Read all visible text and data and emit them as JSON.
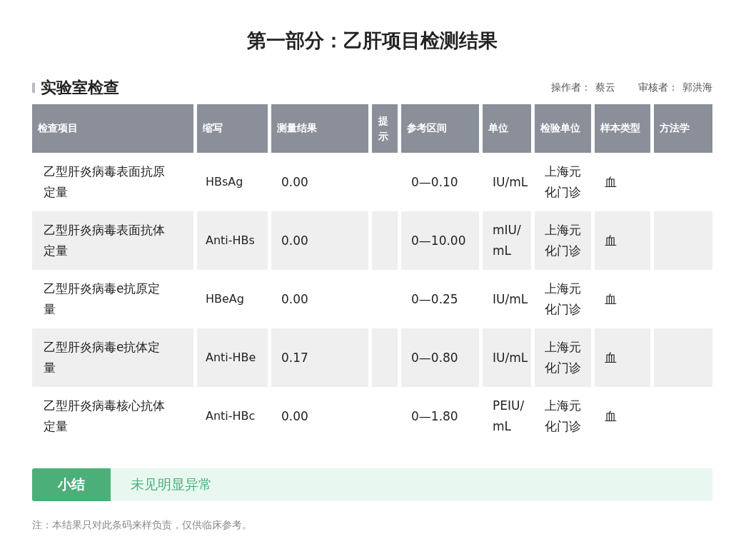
{
  "title": "第一部分：乙肝项目检测结果",
  "section": {
    "title": "实验室检查",
    "operator_label": "操作者：",
    "operator": "蔡云",
    "reviewer_label": "审核者：",
    "reviewer": "郭洪海"
  },
  "table": {
    "columns": [
      {
        "label": "检查项目"
      },
      {
        "label": "缩写"
      },
      {
        "label": "测量结果"
      },
      {
        "label": "提示"
      },
      {
        "label": "参考区间"
      },
      {
        "label": "单位"
      },
      {
        "label": "检验单位"
      },
      {
        "label": "样本类型"
      },
      {
        "label": "方法学"
      }
    ],
    "rows": [
      {
        "item": "乙型肝炎病毒表面抗原定量",
        "abbr": "HBsAg",
        "result": "0.00",
        "range": "0—0.10",
        "unit": "IU/mL",
        "lab": "上海元化门诊",
        "sample": "血"
      },
      {
        "item": "乙型肝炎病毒表面抗体定量",
        "abbr": "Anti-HBs",
        "result": "0.00",
        "range": "0—10.00",
        "unit": "mIU/mL",
        "lab": "上海元化门诊",
        "sample": "血"
      },
      {
        "item": "乙型肝炎病毒e抗原定量",
        "abbr": "HBeAg",
        "result": "0.00",
        "range": "0—0.25",
        "unit": "IU/mL",
        "lab": "上海元化门诊",
        "sample": "血"
      },
      {
        "item": "乙型肝炎病毒e抗体定量",
        "abbr": "Anti-HBe",
        "result": "0.17",
        "range": "0—0.80",
        "unit": "IU/mL",
        "lab": "上海元化门诊",
        "sample": "血"
      },
      {
        "item": "乙型肝炎病毒核心抗体定量",
        "abbr": "Anti-HBc",
        "result": "0.00",
        "range": "0—1.80",
        "unit": "PEIU/mL",
        "lab": "上海元化门诊",
        "sample": "血"
      }
    ]
  },
  "summary": {
    "label": "小结",
    "text": "未见明显异常"
  },
  "note": "注：本结果只对此条码来样负责，仅供临床参考。"
}
